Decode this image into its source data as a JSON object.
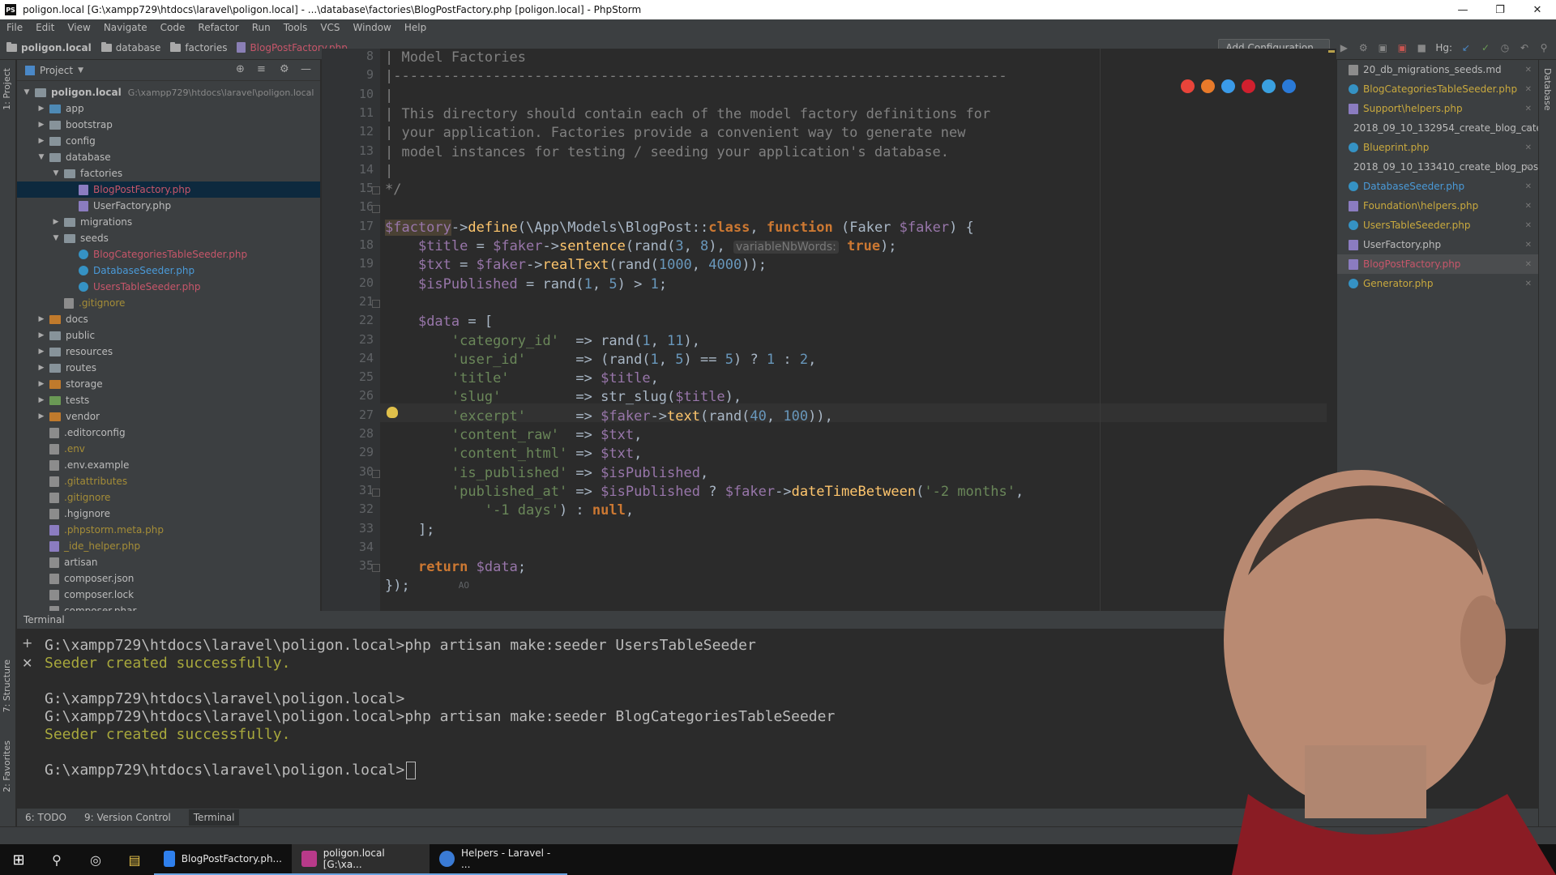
{
  "title_bar": {
    "text": "poligon.local [G:\\xampp729\\htdocs\\laravel\\poligon.local] - ...\\database\\factories\\BlogPostFactory.php [poligon.local] - PhpStorm",
    "app_icon": "PS"
  },
  "menu": [
    "File",
    "Edit",
    "View",
    "Navigate",
    "Code",
    "Refactor",
    "Run",
    "Tools",
    "VCS",
    "Window",
    "Help"
  ],
  "breadcrumbs": [
    "poligon.local",
    "database",
    "factories",
    "BlogPostFactory.php"
  ],
  "toolbar": {
    "add_configuration": "Add Configuration...",
    "vcs_label": "Hg:"
  },
  "left_strip": {
    "project_tab": "1: Project",
    "structure_tab": "7: Structure",
    "favorites_tab": "2: Favorites"
  },
  "right_strip": {
    "database_tab": "Database"
  },
  "project_panel": {
    "title": "Project",
    "tree": [
      {
        "label": "poligon.local",
        "path": "G:\\xampp729\\htdocs\\laravel\\poligon.local",
        "depth": 0,
        "type": "root",
        "expanded": true
      },
      {
        "label": "app",
        "depth": 1,
        "type": "dir",
        "color": "blue"
      },
      {
        "label": "bootstrap",
        "depth": 1,
        "type": "dir"
      },
      {
        "label": "config",
        "depth": 1,
        "type": "dir"
      },
      {
        "label": "database",
        "depth": 1,
        "type": "dir",
        "expanded": true
      },
      {
        "label": "factories",
        "depth": 2,
        "type": "dir",
        "expanded": true
      },
      {
        "label": "BlogPostFactory.php",
        "depth": 3,
        "type": "php",
        "color": "red",
        "selected": true
      },
      {
        "label": "UserFactory.php",
        "depth": 3,
        "type": "php"
      },
      {
        "label": "migrations",
        "depth": 2,
        "type": "dir"
      },
      {
        "label": "seeds",
        "depth": 2,
        "type": "dir",
        "expanded": true
      },
      {
        "label": "BlogCategoriesTableSeeder.php",
        "depth": 3,
        "type": "class",
        "color": "red"
      },
      {
        "label": "DatabaseSeeder.php",
        "depth": 3,
        "type": "class",
        "color": "blue"
      },
      {
        "label": "UsersTableSeeder.php",
        "depth": 3,
        "type": "class",
        "color": "red"
      },
      {
        "label": ".gitignore",
        "depth": 2,
        "type": "gen",
        "color": "olive"
      },
      {
        "label": "docs",
        "depth": 1,
        "type": "dir",
        "color": "orange"
      },
      {
        "label": "public",
        "depth": 1,
        "type": "dir"
      },
      {
        "label": "resources",
        "depth": 1,
        "type": "dir"
      },
      {
        "label": "routes",
        "depth": 1,
        "type": "dir"
      },
      {
        "label": "storage",
        "depth": 1,
        "type": "dir",
        "color": "orange"
      },
      {
        "label": "tests",
        "depth": 1,
        "type": "dir",
        "color": "green"
      },
      {
        "label": "vendor",
        "depth": 1,
        "type": "dir",
        "color": "orange"
      },
      {
        "label": ".editorconfig",
        "depth": 1,
        "type": "gen"
      },
      {
        "label": ".env",
        "depth": 1,
        "type": "gen",
        "color": "olive"
      },
      {
        "label": ".env.example",
        "depth": 1,
        "type": "gen"
      },
      {
        "label": ".gitattributes",
        "depth": 1,
        "type": "gen",
        "color": "olive"
      },
      {
        "label": ".gitignore",
        "depth": 1,
        "type": "gen",
        "color": "olive"
      },
      {
        "label": ".hgignore",
        "depth": 1,
        "type": "gen"
      },
      {
        "label": ".phpstorm.meta.php",
        "depth": 1,
        "type": "php",
        "color": "olive"
      },
      {
        "label": "_ide_helper.php",
        "depth": 1,
        "type": "php",
        "color": "olive"
      },
      {
        "label": "artisan",
        "depth": 1,
        "type": "gen"
      },
      {
        "label": "composer.json",
        "depth": 1,
        "type": "gen"
      },
      {
        "label": "composer.lock",
        "depth": 1,
        "type": "gen"
      },
      {
        "label": "composer.phar",
        "depth": 1,
        "type": "gen"
      }
    ]
  },
  "editor": {
    "line_numbers": [
      "8",
      "9",
      "10",
      "11",
      "12",
      "13",
      "14",
      "15",
      "16",
      "17",
      "18",
      "19",
      "20",
      "21",
      "22",
      "23",
      "24",
      "25",
      "26",
      "27",
      "28",
      "29",
      "30",
      "31",
      "32",
      "33",
      "34",
      "35"
    ],
    "lines": [
      [
        {
          "t": "| Model Factories",
          "c": "cm"
        }
      ],
      [
        {
          "t": "|--------------------------------------------------------------------------",
          "c": "cm"
        }
      ],
      [
        {
          "t": "|",
          "c": "cm"
        }
      ],
      [
        {
          "t": "| This directory should contain each of the model factory definitions for",
          "c": "cm"
        }
      ],
      [
        {
          "t": "| your application. Factories provide a convenient way to generate new",
          "c": "cm"
        }
      ],
      [
        {
          "t": "| model instances for testing / seeding your application's database.",
          "c": "cm"
        }
      ],
      [
        {
          "t": "|",
          "c": "cm"
        }
      ],
      [
        {
          "t": "*/",
          "c": "cm"
        }
      ],
      [],
      [
        {
          "t": "$factory",
          "c": "var hl"
        },
        {
          "t": "->"
        },
        {
          "t": "define",
          "c": "fn"
        },
        {
          "t": "(\\App\\Models\\BlogPost::"
        },
        {
          "t": "class",
          "c": "kw"
        },
        {
          "t": ", "
        },
        {
          "t": "function",
          "c": "kw"
        },
        {
          "t": " (Faker "
        },
        {
          "t": "$faker",
          "c": "var"
        },
        {
          "t": ") {"
        }
      ],
      [
        {
          "t": "    "
        },
        {
          "t": "$title",
          "c": "var"
        },
        {
          "t": " = "
        },
        {
          "t": "$faker",
          "c": "var"
        },
        {
          "t": "->"
        },
        {
          "t": "sentence",
          "c": "fn"
        },
        {
          "t": "(rand("
        },
        {
          "t": "3",
          "c": "num"
        },
        {
          "t": ", "
        },
        {
          "t": "8",
          "c": "num"
        },
        {
          "t": "), "
        },
        {
          "t": "variableNbWords:",
          "c": "hint"
        },
        {
          "t": " "
        },
        {
          "t": "true",
          "c": "kw"
        },
        {
          "t": ");"
        }
      ],
      [
        {
          "t": "    "
        },
        {
          "t": "$txt",
          "c": "var"
        },
        {
          "t": " = "
        },
        {
          "t": "$faker",
          "c": "var"
        },
        {
          "t": "->"
        },
        {
          "t": "realText",
          "c": "fn"
        },
        {
          "t": "(rand("
        },
        {
          "t": "1000",
          "c": "num"
        },
        {
          "t": ", "
        },
        {
          "t": "4000",
          "c": "num"
        },
        {
          "t": "));"
        }
      ],
      [
        {
          "t": "    "
        },
        {
          "t": "$isPublished",
          "c": "var"
        },
        {
          "t": " = rand("
        },
        {
          "t": "1",
          "c": "num"
        },
        {
          "t": ", "
        },
        {
          "t": "5",
          "c": "num"
        },
        {
          "t": ") > "
        },
        {
          "t": "1",
          "c": "num"
        },
        {
          "t": ";"
        }
      ],
      [],
      [
        {
          "t": "    "
        },
        {
          "t": "$data",
          "c": "var"
        },
        {
          "t": " = ["
        }
      ],
      [
        {
          "t": "        "
        },
        {
          "t": "'category_id'",
          "c": "str"
        },
        {
          "t": "  => rand("
        },
        {
          "t": "1",
          "c": "num"
        },
        {
          "t": ", "
        },
        {
          "t": "11",
          "c": "num"
        },
        {
          "t": "),"
        }
      ],
      [
        {
          "t": "        "
        },
        {
          "t": "'user_id'",
          "c": "str"
        },
        {
          "t": "      => (rand("
        },
        {
          "t": "1",
          "c": "num"
        },
        {
          "t": ", "
        },
        {
          "t": "5",
          "c": "num"
        },
        {
          "t": ") == "
        },
        {
          "t": "5",
          "c": "num"
        },
        {
          "t": ") ? "
        },
        {
          "t": "1",
          "c": "num"
        },
        {
          "t": " : "
        },
        {
          "t": "2",
          "c": "num"
        },
        {
          "t": ","
        }
      ],
      [
        {
          "t": "        "
        },
        {
          "t": "'title'",
          "c": "str"
        },
        {
          "t": "        => "
        },
        {
          "t": "$title",
          "c": "var"
        },
        {
          "t": ","
        }
      ],
      [
        {
          "t": "        "
        },
        {
          "t": "'slug'",
          "c": "str"
        },
        {
          "t": "         => str_slug("
        },
        {
          "t": "$title",
          "c": "var"
        },
        {
          "t": "),"
        }
      ],
      [
        {
          "t": "        "
        },
        {
          "t": "'excerpt'",
          "c": "str"
        },
        {
          "t": "      => "
        },
        {
          "t": "$faker",
          "c": "var"
        },
        {
          "t": "->"
        },
        {
          "t": "text",
          "c": "fn"
        },
        {
          "t": "(rand("
        },
        {
          "t": "40",
          "c": "num"
        },
        {
          "t": ", "
        },
        {
          "t": "100",
          "c": "num"
        },
        {
          "t": ")),"
        }
      ],
      [
        {
          "t": "        "
        },
        {
          "t": "'content_raw'",
          "c": "str"
        },
        {
          "t": "  => "
        },
        {
          "t": "$txt",
          "c": "var"
        },
        {
          "t": ","
        }
      ],
      [
        {
          "t": "        "
        },
        {
          "t": "'content_html'",
          "c": "str"
        },
        {
          "t": " => "
        },
        {
          "t": "$txt",
          "c": "var"
        },
        {
          "t": ","
        }
      ],
      [
        {
          "t": "        "
        },
        {
          "t": "'is_published'",
          "c": "str"
        },
        {
          "t": " => "
        },
        {
          "t": "$isPublished",
          "c": "var"
        },
        {
          "t": ","
        }
      ],
      [
        {
          "t": "        "
        },
        {
          "t": "'published_at'",
          "c": "str"
        },
        {
          "t": " => "
        },
        {
          "t": "$isPublished",
          "c": "var"
        },
        {
          "t": " ? "
        },
        {
          "t": "$faker",
          "c": "var"
        },
        {
          "t": "->"
        },
        {
          "t": "dateTimeBetween",
          "c": "fn"
        },
        {
          "t": "("
        },
        {
          "t": "'-2 months'",
          "c": "str"
        },
        {
          "t": ","
        }
      ],
      [
        {
          "t": "            "
        },
        {
          "t": "'-1 days'",
          "c": "str"
        },
        {
          "t": ") : "
        },
        {
          "t": "null",
          "c": "kw"
        },
        {
          "t": ","
        }
      ],
      [
        {
          "t": "    ];"
        }
      ],
      [],
      [
        {
          "t": "    "
        },
        {
          "t": "return",
          "c": "kw"
        },
        {
          "t": " "
        },
        {
          "t": "$data",
          "c": "var"
        },
        {
          "t": ";"
        }
      ],
      [
        {
          "t": "});"
        }
      ]
    ],
    "caret_line": "26",
    "bottom_indicator": "AO"
  },
  "recent_files": [
    {
      "label": "20_db_migrations_seeds.md",
      "type": "gen"
    },
    {
      "label": "BlogCategoriesTableSeeder.php",
      "type": "class",
      "color": "olive"
    },
    {
      "label": "Support\\helpers.php",
      "type": "php",
      "color": "olive"
    },
    {
      "label": "2018_09_10_132954_create_blog_cate",
      "type": "php"
    },
    {
      "label": "Blueprint.php",
      "type": "class",
      "color": "olive"
    },
    {
      "label": "2018_09_10_133410_create_blog_post",
      "type": "php"
    },
    {
      "label": "DatabaseSeeder.php",
      "type": "class",
      "color": "blue"
    },
    {
      "label": "Foundation\\helpers.php",
      "type": "php",
      "color": "olive"
    },
    {
      "label": "UsersTableSeeder.php",
      "type": "class",
      "color": "olive"
    },
    {
      "label": "UserFactory.php",
      "type": "php"
    },
    {
      "label": "BlogPostFactory.php",
      "type": "php",
      "color": "red",
      "active": true
    },
    {
      "label": "Generator.php",
      "type": "class",
      "color": "olive"
    }
  ],
  "terminal": {
    "header": "Terminal",
    "lines": [
      {
        "text": "G:\\xampp729\\htdocs\\laravel\\poligon.local>php artisan make:seeder UsersTableSeeder",
        "kind": "cmd"
      },
      {
        "text": "Seeder created successfully.",
        "kind": "ok"
      },
      {
        "text": "",
        "kind": "cmd"
      },
      {
        "text": "G:\\xampp729\\htdocs\\laravel\\poligon.local>",
        "kind": "cmd"
      },
      {
        "text": "G:\\xampp729\\htdocs\\laravel\\poligon.local>php artisan make:seeder BlogCategoriesTableSeeder",
        "kind": "cmd"
      },
      {
        "text": "Seeder created successfully.",
        "kind": "ok"
      },
      {
        "text": "",
        "kind": "cmd"
      },
      {
        "text": "G:\\xampp729\\htdocs\\laravel\\poligon.local>",
        "kind": "prompt"
      }
    ]
  },
  "bottom_tabs": [
    "6: TODO",
    "9: Version Control",
    "Terminal"
  ],
  "taskbar": {
    "apps": [
      {
        "label": "BlogPostFactory.ph...",
        "icon": "vscode-icon",
        "color": "#2f80ed"
      },
      {
        "label": "poligon.local [G:\\xa...",
        "icon": "phpstorm-icon",
        "color": "#b83a8a"
      },
      {
        "label": "Helpers - Laravel - ...",
        "icon": "browser-icon",
        "color": "#3a7bd5"
      }
    ]
  },
  "colors": {
    "editor_bg": "#2b2b2b",
    "panel_bg": "#3c3f41",
    "keyword": "#cc7832",
    "variable": "#9876aa",
    "function": "#ffc66d",
    "string": "#6a8759",
    "number": "#6897bb",
    "comment": "#808080",
    "terminal_ok": "#a8a83c"
  }
}
